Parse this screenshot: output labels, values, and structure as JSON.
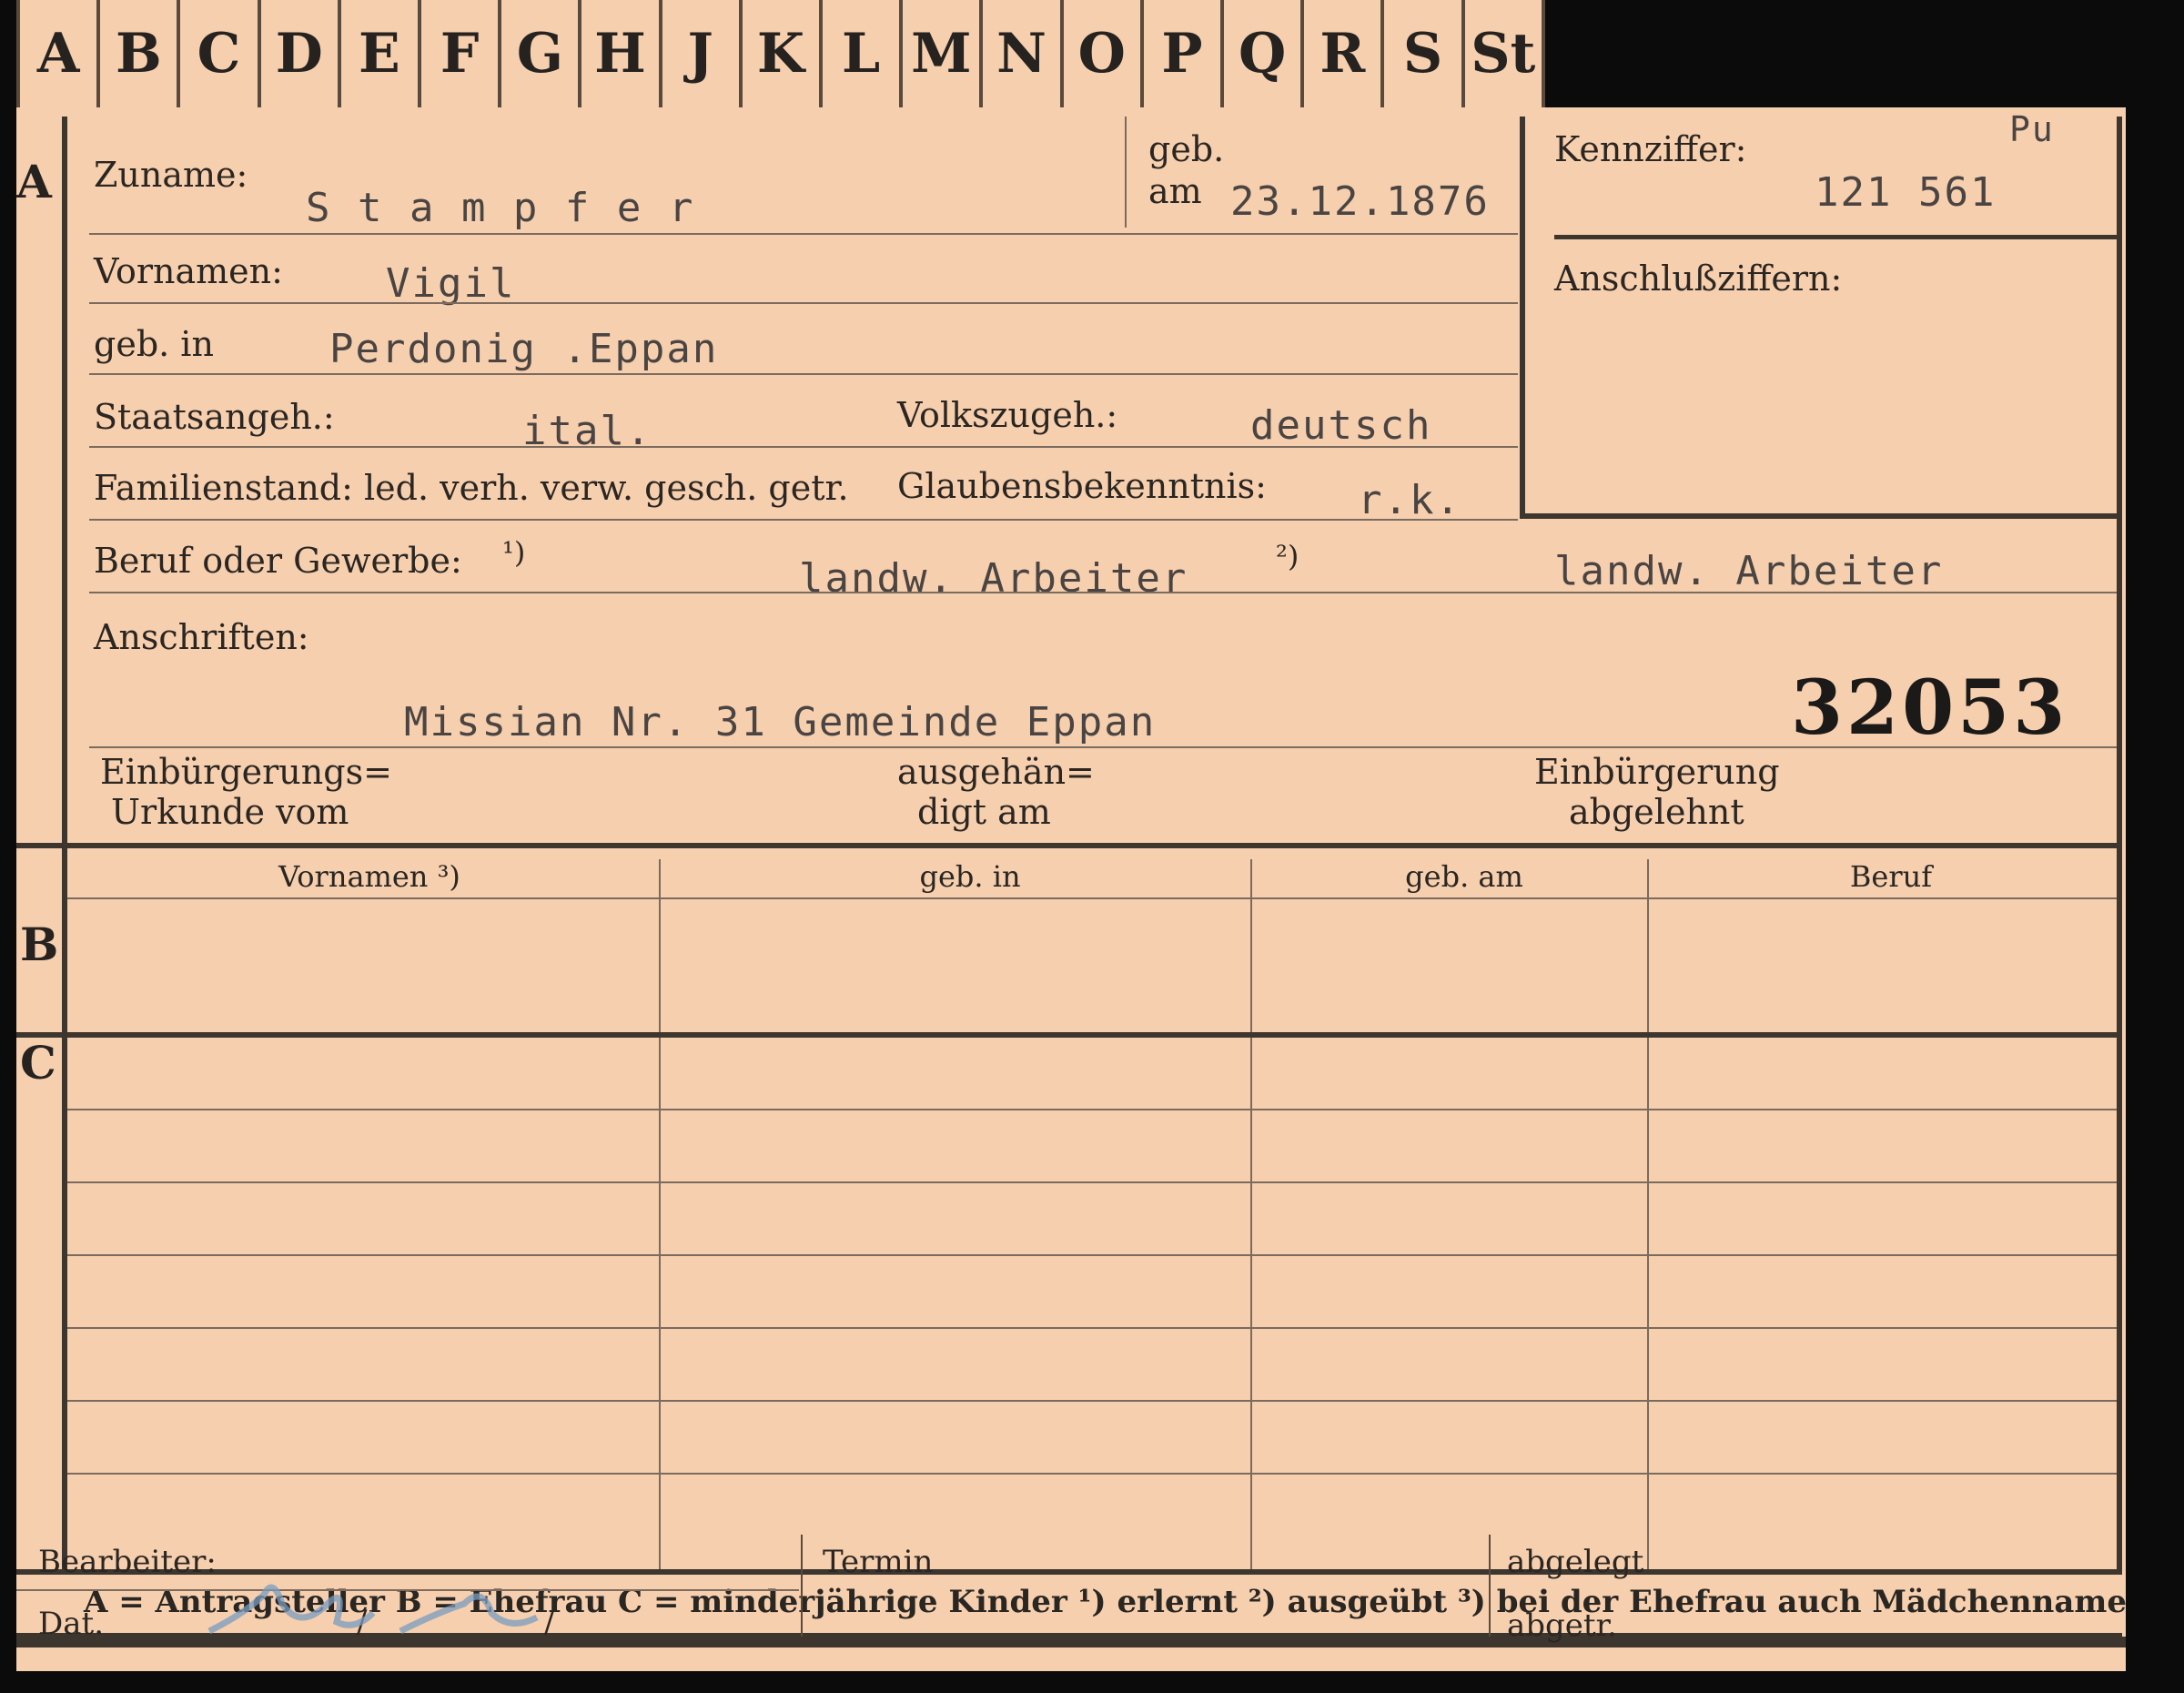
{
  "tabs": [
    "A",
    "B",
    "C",
    "D",
    "E",
    "F",
    "G",
    "H",
    "J",
    "K",
    "L",
    "M",
    "N",
    "O",
    "P",
    "Q",
    "R",
    "S",
    "St"
  ],
  "section_letters": {
    "a": "A",
    "b": "B",
    "c": "C"
  },
  "applicant": {
    "surname_label": "Zuname:",
    "surname": "S t a m p f e r",
    "born_label_1": "geb.",
    "born_label_2": "am",
    "birth_date": "23.12.1876",
    "given_names_label": "Vornamen:",
    "given_names": "Vigil",
    "birthplace_label": "geb. in",
    "birthplace": "Perdonig .Eppan",
    "citizenship_label": "Staatsangeh.:",
    "citizenship": "ital.",
    "ethnicity_label": "Volkszugeh.:",
    "ethnicity": "deutsch",
    "family_status_label": "Familienstand: led. verh. verw. gesch. getr.",
    "religion_label": "Glaubensbekenntnis:",
    "religion": "r.k.",
    "profession_label": "Beruf oder Gewerbe:",
    "profession_note_1": "¹)",
    "profession_learned": "landw. Arbeiter",
    "profession_note_2": "²)",
    "profession_practiced": "landw. Arbeiter",
    "address_label": "Anschriften:",
    "address": "Missian Nr. 31 Gemeinde Eppan",
    "file_number": "32053",
    "naturalization_cert_label_1": "Einbürgerungs=",
    "naturalization_cert_label_2": "Urkunde vom",
    "handed_out_label_1": "ausgehän=",
    "handed_out_label_2": "digt am",
    "naturalization_refused_label_1": "Einbürgerung",
    "naturalization_refused_label_2": "abgelehnt"
  },
  "id_box": {
    "kennziffer_label": "Kennziffer:",
    "prefix": "Pu",
    "kennziffer": "121 561",
    "anschluss_label": "Anschlußziffern:"
  },
  "table": {
    "headers": [
      "Vornamen ³)",
      "geb. in",
      "geb. am",
      "Beruf"
    ]
  },
  "legend": "A = Antragsteller   B = Ehefrau   C = minderjährige Kinder   ¹) erlernt   ²) ausgeübt   ³) bei der Ehefrau auch Mädchenname",
  "footer": {
    "processor_label": "Bearbeiter:",
    "date_label": "Dat.",
    "date_sep_1": "/",
    "date_sep_2": "/",
    "deadline_label": "Termin",
    "filed_label": "abgelegt",
    "removed_label": "abgetr."
  },
  "colors": {
    "paper": "#f6cfae",
    "ink": "#2b2622",
    "type": "#4a4442",
    "stamp_blue": "#7a9cc0"
  }
}
